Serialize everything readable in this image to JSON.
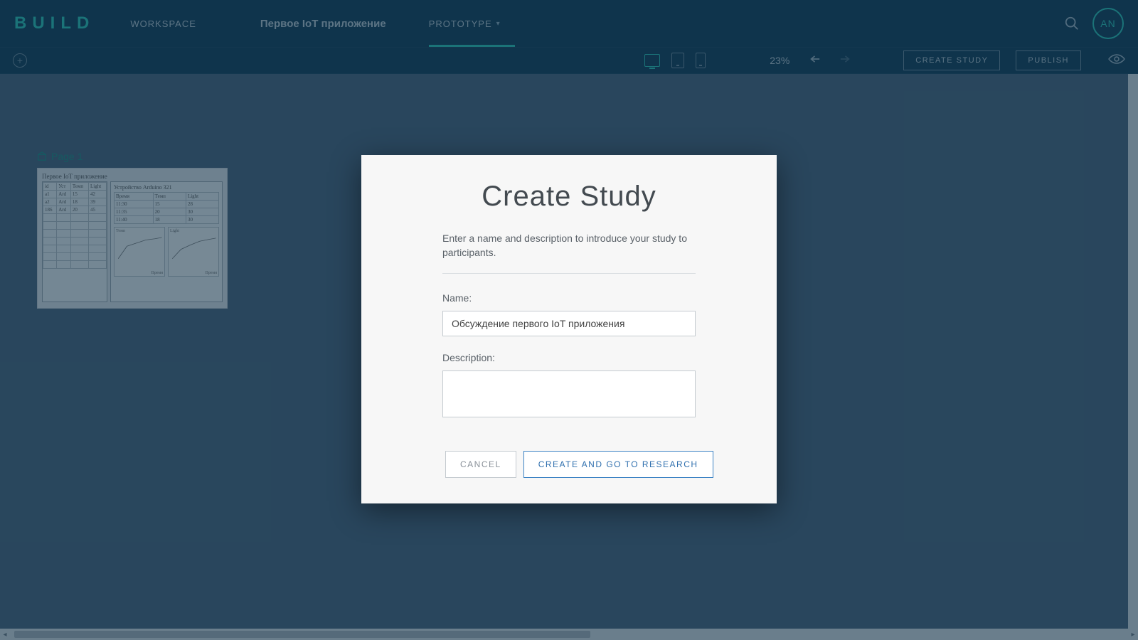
{
  "brand": "BUILD",
  "header": {
    "workspace": "WORKSPACE",
    "project": "Первое IoT приложение",
    "active_tab": "PROTOTYPE",
    "avatar_initials": "AN"
  },
  "toolbar": {
    "zoom": "23%",
    "create_study": "CREATE STUDY",
    "publish": "PUBLISH"
  },
  "page_thumb": {
    "label": "Page 1",
    "sketch_title": "Первое IoT приложение",
    "left_headers": [
      "id",
      "Уст",
      "Темп",
      "Light"
    ],
    "left_rows": [
      [
        "a1",
        "Ard",
        "15",
        "42"
      ],
      [
        "a2",
        "Ard",
        "18",
        "39"
      ],
      [
        "186",
        "Ard",
        "20",
        "45"
      ]
    ],
    "right_title": "Устройство Arduino 321",
    "right_headers": [
      "Время",
      "Темп",
      "Light"
    ],
    "right_rows": [
      [
        "11:30",
        "15",
        "28"
      ],
      [
        "11:35",
        "20",
        "30"
      ],
      [
        "11:40",
        "18",
        "30"
      ]
    ],
    "chart1_y": "Темп",
    "chart2_y": "Light",
    "chart_x": "Время"
  },
  "modal": {
    "title": "Create Study",
    "intro": "Enter a name and description to introduce your study to participants.",
    "name_label": "Name:",
    "name_value": "Обсуждение первого IoT приложения",
    "desc_label": "Description:",
    "desc_value": "",
    "cancel": "CANCEL",
    "confirm": "CREATE AND GO TO RESEARCH"
  }
}
